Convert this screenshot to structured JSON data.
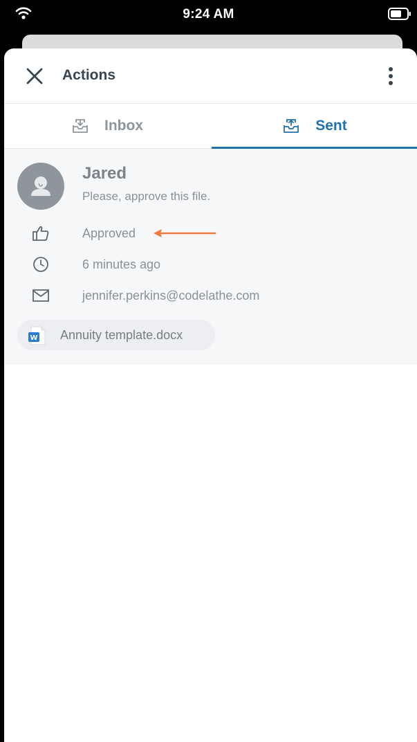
{
  "status_bar": {
    "time": "9:24 AM",
    "icons": [
      "wifi-icon",
      "battery-icon"
    ]
  },
  "header": {
    "title": "Actions",
    "close_icon": "close-icon",
    "menu_icon": "more-vertical-icon"
  },
  "tabs": [
    {
      "label": "Inbox",
      "icon": "inbox-icon",
      "active": false
    },
    {
      "label": "Sent",
      "icon": "outbox-icon",
      "active": true
    }
  ],
  "action": {
    "sender": "Jared",
    "message": "Please, approve this file.",
    "status": "Approved",
    "time_ago": "6 minutes ago",
    "email": "jennifer.perkins@codelathe.com",
    "attachment": {
      "name": "Annuity template.docx",
      "icon": "word-doc-icon"
    }
  },
  "colors": {
    "accent": "#1f72ad",
    "annotation_arrow": "#f07a3e",
    "detail_background": "#f6f7f9"
  }
}
